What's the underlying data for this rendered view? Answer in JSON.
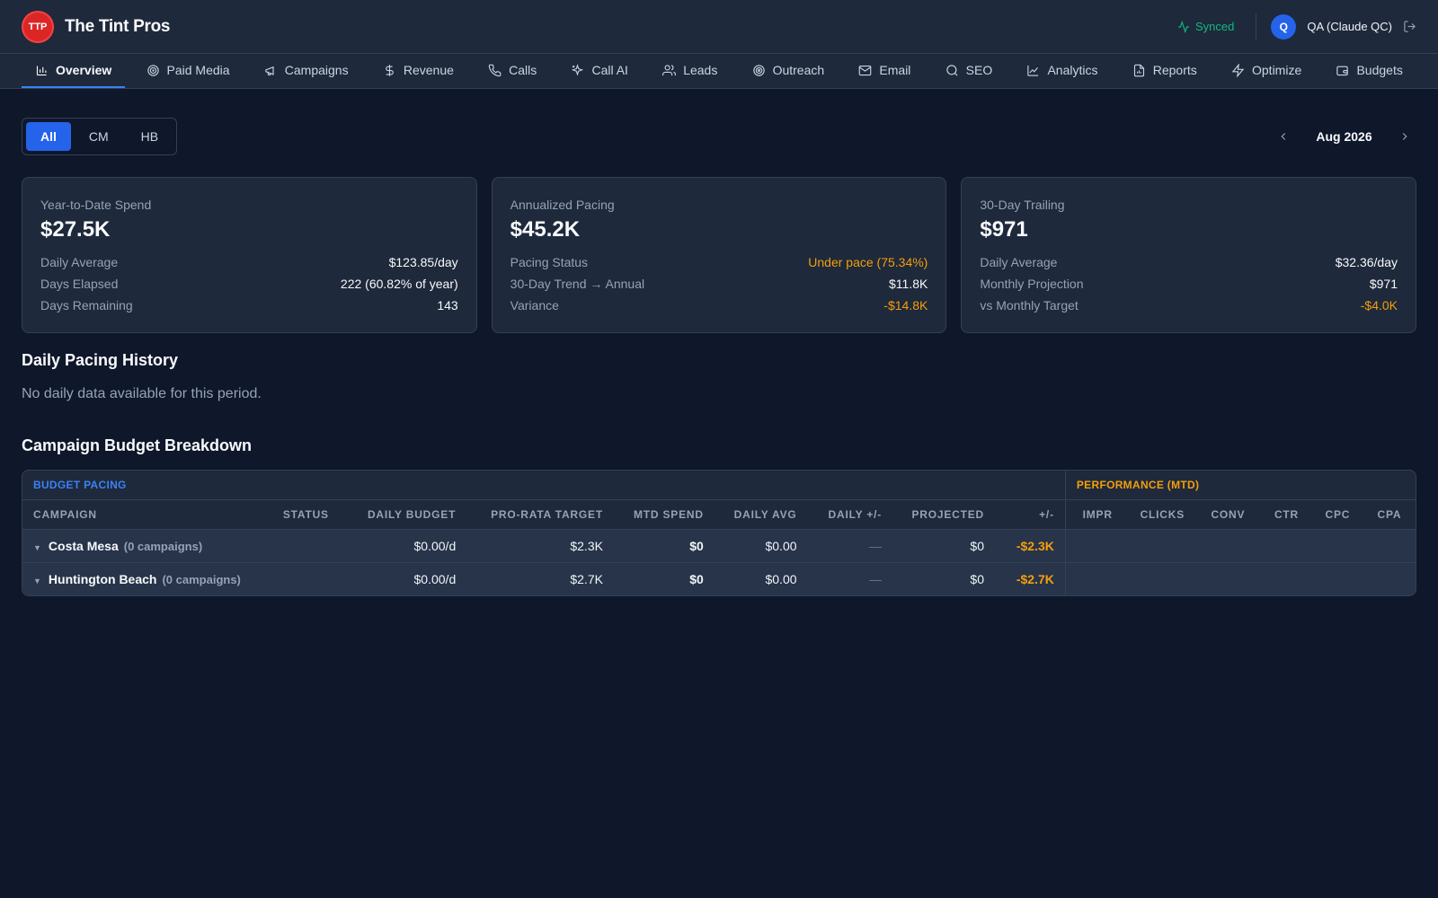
{
  "app": {
    "logo_text": "TTP",
    "brand": "The Tint Pros",
    "sync_status": "Synced",
    "user_initial": "Q",
    "user_name": "QA (Claude QC)",
    "accent_color": "#2563eb",
    "warning_color": "#f59e0b",
    "success_color": "#10b981"
  },
  "nav": {
    "items": [
      {
        "label": "Overview",
        "icon": "bar-chart-icon",
        "active": true
      },
      {
        "label": "Paid Media",
        "icon": "target-icon"
      },
      {
        "label": "Campaigns",
        "icon": "megaphone-icon"
      },
      {
        "label": "Revenue",
        "icon": "dollar-icon"
      },
      {
        "label": "Calls",
        "icon": "phone-icon"
      },
      {
        "label": "Call AI",
        "icon": "sparkles-icon"
      },
      {
        "label": "Leads",
        "icon": "users-icon"
      },
      {
        "label": "Outreach",
        "icon": "radar-icon"
      },
      {
        "label": "Email",
        "icon": "mail-icon"
      },
      {
        "label": "SEO",
        "icon": "search-icon"
      },
      {
        "label": "Analytics",
        "icon": "line-chart-icon"
      },
      {
        "label": "Reports",
        "icon": "file-icon"
      },
      {
        "label": "Optimize",
        "icon": "zap-icon"
      },
      {
        "label": "Budgets",
        "icon": "wallet-icon"
      }
    ]
  },
  "filters": {
    "segments": [
      "All",
      "CM",
      "HB"
    ],
    "selected": "All",
    "month": "Aug 2026"
  },
  "cards": [
    {
      "label": "Year-to-Date Spend",
      "value": "$27.5K",
      "rows": [
        {
          "k": "Daily Average",
          "v": "$123.85/day"
        },
        {
          "k": "Days Elapsed",
          "v": "222 (60.82% of year)"
        },
        {
          "k": "Days Remaining",
          "v": "143"
        }
      ]
    },
    {
      "label": "Annualized Pacing",
      "value": "$45.2K",
      "rows": [
        {
          "k": "Pacing Status",
          "v": "Under pace (75.34%)"
        },
        {
          "k": "30-Day Trend → Annual",
          "v": "$11.8K"
        },
        {
          "k": "Variance",
          "v": "-$14.8K"
        }
      ]
    },
    {
      "label": "30-Day Trailing",
      "value": "$971",
      "rows": [
        {
          "k": "Daily Average",
          "v": "$32.36/day"
        },
        {
          "k": "Monthly Projection",
          "v": "$971"
        },
        {
          "k": "vs Monthly Target",
          "v": "-$4.0K"
        }
      ]
    }
  ],
  "daily_history": {
    "title": "Daily Pacing History",
    "empty_message": "No daily data available for this period."
  },
  "breakdown": {
    "title": "Campaign Budget Breakdown",
    "group_budget": "BUDGET PACING",
    "group_perf": "PERFORMANCE (MTD)",
    "columns": [
      "CAMPAIGN",
      "STATUS",
      "DAILY BUDGET",
      "PRO-RATA TARGET",
      "MTD SPEND",
      "DAILY AVG",
      "DAILY +/-",
      "PROJECTED",
      "+/-",
      "IMPR",
      "CLICKS",
      "CONV",
      "CTR",
      "CPC",
      "CPA"
    ],
    "rows": [
      {
        "name": "Costa Mesa",
        "count": "(0 campaigns)",
        "status": "",
        "daily_budget": "$0.00/d",
        "pro_rata": "$2.3K",
        "mtd_spend": "$0",
        "daily_avg": "$0.00",
        "daily_diff": "—",
        "projected": "$0",
        "diff": "-$2.3K"
      },
      {
        "name": "Huntington Beach",
        "count": "(0 campaigns)",
        "status": "",
        "daily_budget": "$0.00/d",
        "pro_rata": "$2.7K",
        "mtd_spend": "$0",
        "daily_avg": "$0.00",
        "daily_diff": "—",
        "projected": "$0",
        "diff": "-$2.7K"
      }
    ]
  }
}
